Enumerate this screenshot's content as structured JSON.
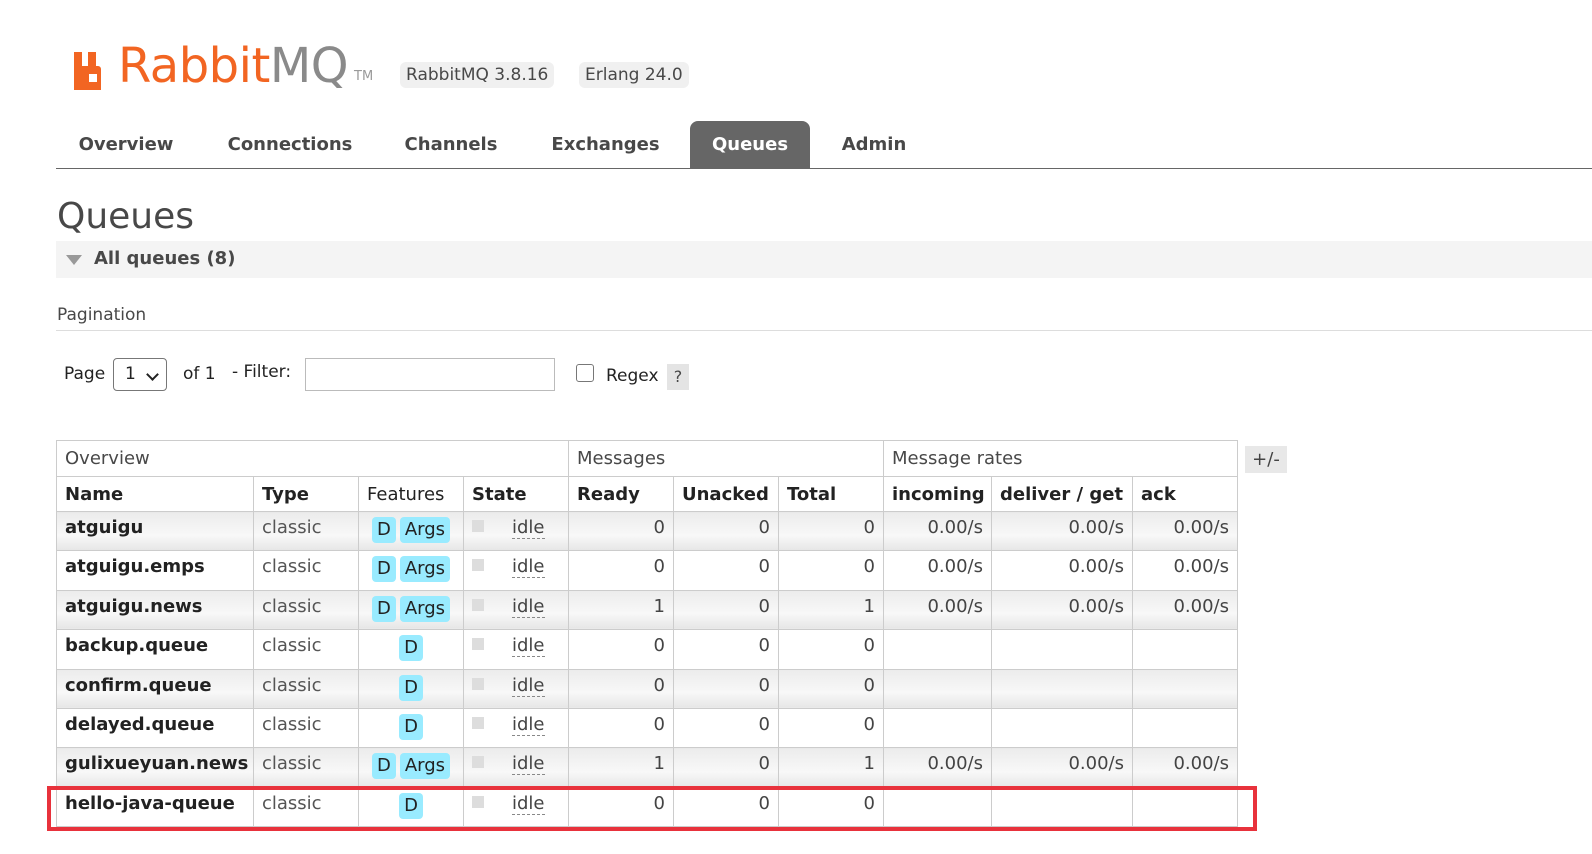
{
  "header": {
    "brand": "RabbitMQ",
    "brand_rabbit": "Rabbit",
    "brand_mq": "MQ",
    "tm": "TM",
    "rabbitmq_version": "RabbitMQ 3.8.16",
    "erlang_version": "Erlang 24.0",
    "brand_color": "#f26522"
  },
  "nav": {
    "tabs": [
      "Overview",
      "Connections",
      "Channels",
      "Exchanges",
      "Queues",
      "Admin"
    ],
    "active": "Queues"
  },
  "page": {
    "title": "Queues",
    "section_label": "All queues (8)",
    "pagination_label": "Pagination"
  },
  "pagination": {
    "page_label": "Page",
    "page_value": "1",
    "of_label": "of 1",
    "filter_label": "- Filter:",
    "filter_value": "",
    "regex_label": "Regex",
    "regex_checked": false,
    "help_label": "?"
  },
  "table": {
    "groups": [
      "Overview",
      "Messages",
      "Message rates"
    ],
    "columns": [
      "Name",
      "Type",
      "Features",
      "State",
      "Ready",
      "Unacked",
      "Total",
      "incoming",
      "deliver / get",
      "ack"
    ],
    "toggle_label": "+/-",
    "rows": [
      {
        "name": "atguigu",
        "type": "classic",
        "features": [
          "D",
          "Args"
        ],
        "state": "idle",
        "ready": "0",
        "unacked": "0",
        "total": "0",
        "incoming": "0.00/s",
        "deliver": "0.00/s",
        "ack": "0.00/s"
      },
      {
        "name": "atguigu.emps",
        "type": "classic",
        "features": [
          "D",
          "Args"
        ],
        "state": "idle",
        "ready": "0",
        "unacked": "0",
        "total": "0",
        "incoming": "0.00/s",
        "deliver": "0.00/s",
        "ack": "0.00/s"
      },
      {
        "name": "atguigu.news",
        "type": "classic",
        "features": [
          "D",
          "Args"
        ],
        "state": "idle",
        "ready": "1",
        "unacked": "0",
        "total": "1",
        "incoming": "0.00/s",
        "deliver": "0.00/s",
        "ack": "0.00/s"
      },
      {
        "name": "backup.queue",
        "type": "classic",
        "features": [
          "D"
        ],
        "state": "idle",
        "ready": "0",
        "unacked": "0",
        "total": "0",
        "incoming": "",
        "deliver": "",
        "ack": ""
      },
      {
        "name": "confirm.queue",
        "type": "classic",
        "features": [
          "D"
        ],
        "state": "idle",
        "ready": "0",
        "unacked": "0",
        "total": "0",
        "incoming": "",
        "deliver": "",
        "ack": ""
      },
      {
        "name": "delayed.queue",
        "type": "classic",
        "features": [
          "D"
        ],
        "state": "idle",
        "ready": "0",
        "unacked": "0",
        "total": "0",
        "incoming": "",
        "deliver": "",
        "ack": ""
      },
      {
        "name": "gulixueyuan.news",
        "type": "classic",
        "features": [
          "D",
          "Args"
        ],
        "state": "idle",
        "ready": "1",
        "unacked": "0",
        "total": "1",
        "incoming": "0.00/s",
        "deliver": "0.00/s",
        "ack": "0.00/s"
      },
      {
        "name": "hello-java-queue",
        "type": "classic",
        "features": [
          "D"
        ],
        "state": "idle",
        "ready": "0",
        "unacked": "0",
        "total": "0",
        "incoming": "",
        "deliver": "",
        "ack": ""
      }
    ],
    "highlighted_row": "hello-java-queue",
    "highlight_color": "#e8323c"
  }
}
